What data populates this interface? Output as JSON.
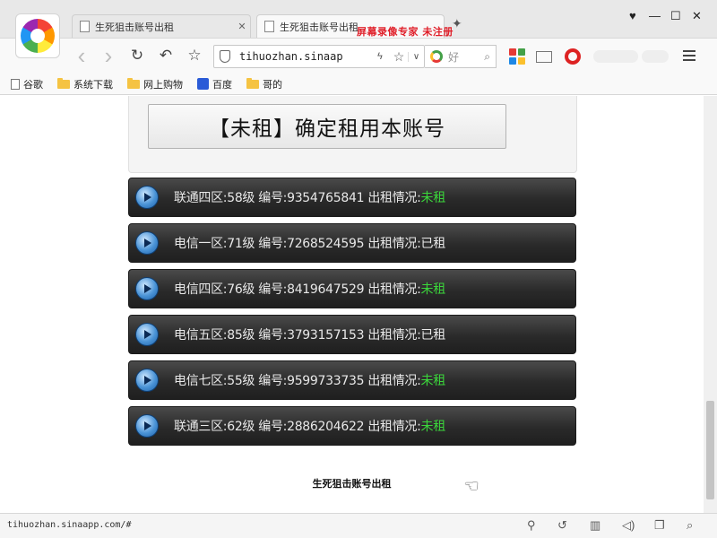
{
  "browser": {
    "tabs": [
      {
        "title": "生死狙击账号出租",
        "active": false
      },
      {
        "title": "生死狙击账号出租",
        "active": true
      }
    ],
    "new_tab_symbol": "✦",
    "watermark": "屏幕录像专家  未注册",
    "window_controls": {
      "skin": "♥",
      "minimize": "—",
      "maximize": "☐",
      "close": "✕"
    },
    "address": {
      "url": "tihuozhan.sinaap",
      "bolt": "ϟ",
      "star": "☆",
      "dropdown": "∨"
    },
    "search": {
      "placeholder": "好",
      "icon": "🔍"
    },
    "nav": {
      "back": "‹",
      "forward": "›",
      "reload": "↻",
      "undo": "↶",
      "star": "☆"
    },
    "bookmarks": [
      {
        "label": "谷歌",
        "icon": "doc"
      },
      {
        "label": "系统下载",
        "icon": "folder"
      },
      {
        "label": "网上购物",
        "icon": "folder"
      },
      {
        "label": "百度",
        "icon": "baidu"
      },
      {
        "label": "哥的",
        "icon": "folder"
      }
    ]
  },
  "page": {
    "confirm_button": "【未租】确定租用本账号",
    "accounts": [
      {
        "label": "联通四区:58级 编号:9354765841 出租情况:",
        "status": "未租",
        "free": true
      },
      {
        "label": "电信一区:71级 编号:7268524595 出租情况:",
        "status": "已租",
        "free": false
      },
      {
        "label": "电信四区:76级 编号:8419647529 出租情况:",
        "status": "未租",
        "free": true
      },
      {
        "label": "电信五区:85级 编号:3793157153 出租情况:",
        "status": "已租",
        "free": false
      },
      {
        "label": "电信七区:55级 编号:9599733735 出租情况:",
        "status": "未租",
        "free": true
      },
      {
        "label": "联通三区:62级 编号:2886204622 出租情况:",
        "status": "未租",
        "free": true
      }
    ],
    "footer": "生死狙击账号出租"
  },
  "statusbar": {
    "url": "tihuozhan.sinaapp.com/#",
    "icons": [
      "pin-icon",
      "refresh-icon",
      "trash-icon",
      "sound-icon",
      "window-icon",
      "search-icon"
    ]
  },
  "colors": {
    "free": "#3bd63b",
    "row_bg": "#2a2a2a",
    "accent_red": "#e0202a"
  }
}
